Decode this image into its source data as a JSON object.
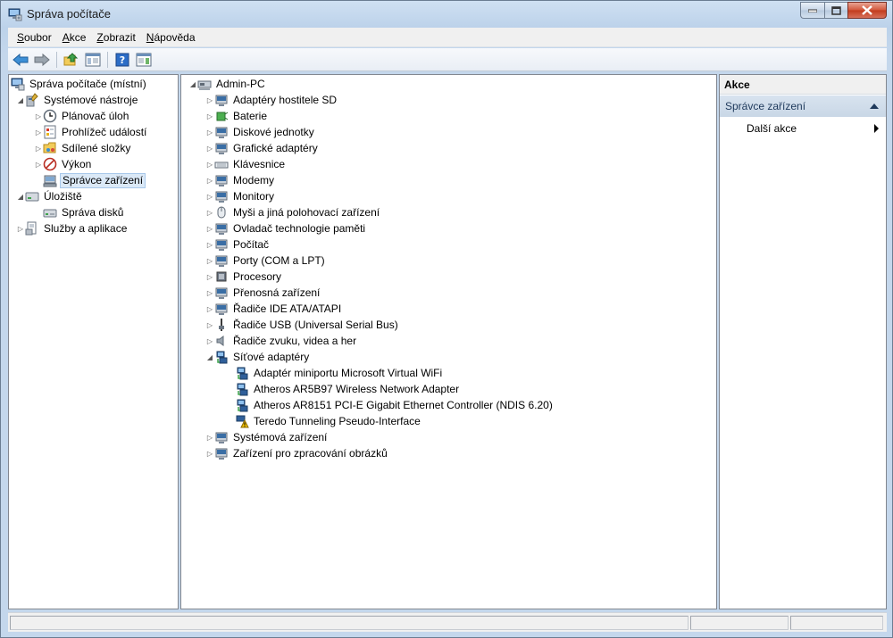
{
  "window": {
    "title": "Správa počítače"
  },
  "menu": [
    {
      "label": "Soubor",
      "accel": "S",
      "rest": "oubor"
    },
    {
      "label": "Akce",
      "accel": "A",
      "rest": "kce"
    },
    {
      "label": "Zobrazit",
      "accel": "Z",
      "rest": "obrazit"
    },
    {
      "label": "Nápověda",
      "accel": "N",
      "rest": "ápověda"
    }
  ],
  "left_tree": [
    {
      "label": "Správa počítače (místní)",
      "icon": "computer-management-icon"
    },
    {
      "label": "Systémové nástroje",
      "icon": "system-tools-icon"
    },
    {
      "label": "Plánovač úloh",
      "icon": "task-scheduler-icon"
    },
    {
      "label": "Prohlížeč událostí",
      "icon": "event-viewer-icon"
    },
    {
      "label": "Sdílené složky",
      "icon": "shared-folders-icon"
    },
    {
      "label": "Výkon",
      "icon": "performance-icon"
    },
    {
      "label": "Správce zařízení",
      "icon": "device-manager-icon"
    },
    {
      "label": "Úložiště",
      "icon": "storage-icon"
    },
    {
      "label": "Správa disků",
      "icon": "disk-management-icon"
    },
    {
      "label": "Služby a aplikace",
      "icon": "services-icon"
    }
  ],
  "device_tree": {
    "root": "Admin-PC",
    "categories": [
      "Adaptéry hostitele SD",
      "Baterie",
      "Diskové jednotky",
      "Grafické adaptéry",
      "Klávesnice",
      "Modemy",
      "Monitory",
      "Myši a jiná polohovací zařízení",
      "Ovladač technologie paměti",
      "Počítač",
      "Porty (COM a LPT)",
      "Procesory",
      "Přenosná zařízení",
      "Řadiče IDE ATA/ATAPI",
      "Řadiče USB (Universal Serial Bus)",
      "Řadiče zvuku, videa a her",
      "Síťové adaptéry"
    ],
    "network_children": [
      "Adaptér miniportu Microsoft Virtual WiFi",
      "Atheros AR5B97 Wireless Network Adapter",
      "Atheros AR8151 PCI-E Gigabit Ethernet Controller (NDIS 6.20)",
      "Teredo Tunneling Pseudo-Interface"
    ],
    "after": [
      "Systémová zařízení",
      "Zařízení pro zpracování obrázků"
    ]
  },
  "actions": {
    "header": "Akce",
    "section": "Správce zařízení",
    "item": "Další akce"
  },
  "colors": {
    "accent": "#3a6ea5",
    "warning": "#f2c200"
  }
}
